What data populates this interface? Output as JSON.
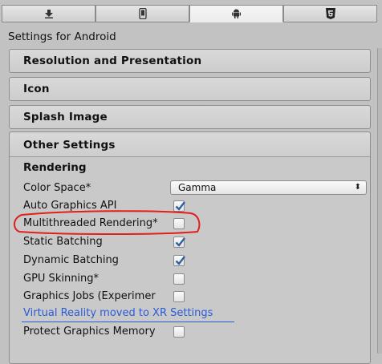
{
  "tabs": [
    {
      "icon": "download-icon",
      "active": false
    },
    {
      "icon": "mobile-device-icon",
      "active": false
    },
    {
      "icon": "android-icon",
      "active": true
    },
    {
      "icon": "html5-icon",
      "active": false
    }
  ],
  "platform_title": "Settings for Android",
  "sections": {
    "resolution": "Resolution and Presentation",
    "icon": "Icon",
    "splash": "Splash Image",
    "other": "Other Settings"
  },
  "rendering": {
    "heading": "Rendering",
    "color_space_label": "Color Space*",
    "color_space_value": "Gamma",
    "settings": [
      {
        "label": "Auto Graphics API",
        "checked": true
      },
      {
        "label": "Multithreaded Rendering*",
        "checked": false
      },
      {
        "label": "Static Batching",
        "checked": true
      },
      {
        "label": "Dynamic Batching",
        "checked": true
      },
      {
        "label": "GPU Skinning*",
        "checked": false
      },
      {
        "label": "Graphics Jobs (Experimer",
        "checked": false
      }
    ],
    "vr_link": "Virtual Reality moved to XR Settings",
    "protect_label": "Protect Graphics Memory",
    "protect_checked": false
  },
  "colors": {
    "link": "#2a5bd7",
    "annotation": "#e0201a",
    "check": "#2f5f9e"
  }
}
